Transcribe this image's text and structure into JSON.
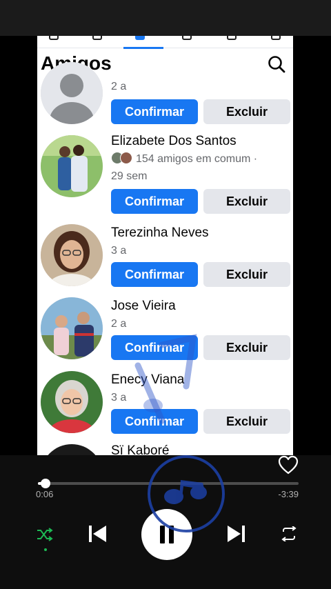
{
  "friends_page": {
    "title": "Amigos",
    "requests": [
      {
        "name": "",
        "subtitle_line1": "2 a",
        "subtitle_line2": "",
        "confirm_label": "Confirmar",
        "delete_label": "Excluir",
        "avatar": "default-avatar"
      },
      {
        "name": "Elizabete Dos Santos",
        "subtitle_line1": "154 amigos em comum ·",
        "subtitle_line2": "29 sem",
        "confirm_label": "Confirmar",
        "delete_label": "Excluir",
        "avatar": "couple-photo"
      },
      {
        "name": "Terezinha Neves",
        "subtitle_line1": "3 a",
        "subtitle_line2": "",
        "confirm_label": "Confirmar",
        "delete_label": "Excluir",
        "avatar": "woman-glasses-photo"
      },
      {
        "name": "Jose Vieira",
        "subtitle_line1": "2 a",
        "subtitle_line2": "",
        "confirm_label": "Confirmar",
        "delete_label": "Excluir",
        "avatar": "couple-outdoor-photo"
      },
      {
        "name": "Enecy Viana",
        "subtitle_line1": "3 a",
        "subtitle_line2": "",
        "confirm_label": "Confirmar",
        "delete_label": "Excluir",
        "avatar": "woman-gray-hair-photo"
      },
      {
        "name": "Sï Kaboré",
        "subtitle_line1": "",
        "subtitle_line2": "",
        "confirm_label": "",
        "delete_label": "",
        "avatar": "partial-photo"
      }
    ]
  },
  "player": {
    "elapsed": "0:06",
    "remaining": "-3:39",
    "progress_fraction": 0.03,
    "shuffle_active": true
  },
  "colors": {
    "facebook_blue": "#1877f2",
    "delete_gray": "#e4e6eb",
    "spotify_green": "#1db954",
    "watermark_blue": "#1c3fa3"
  }
}
